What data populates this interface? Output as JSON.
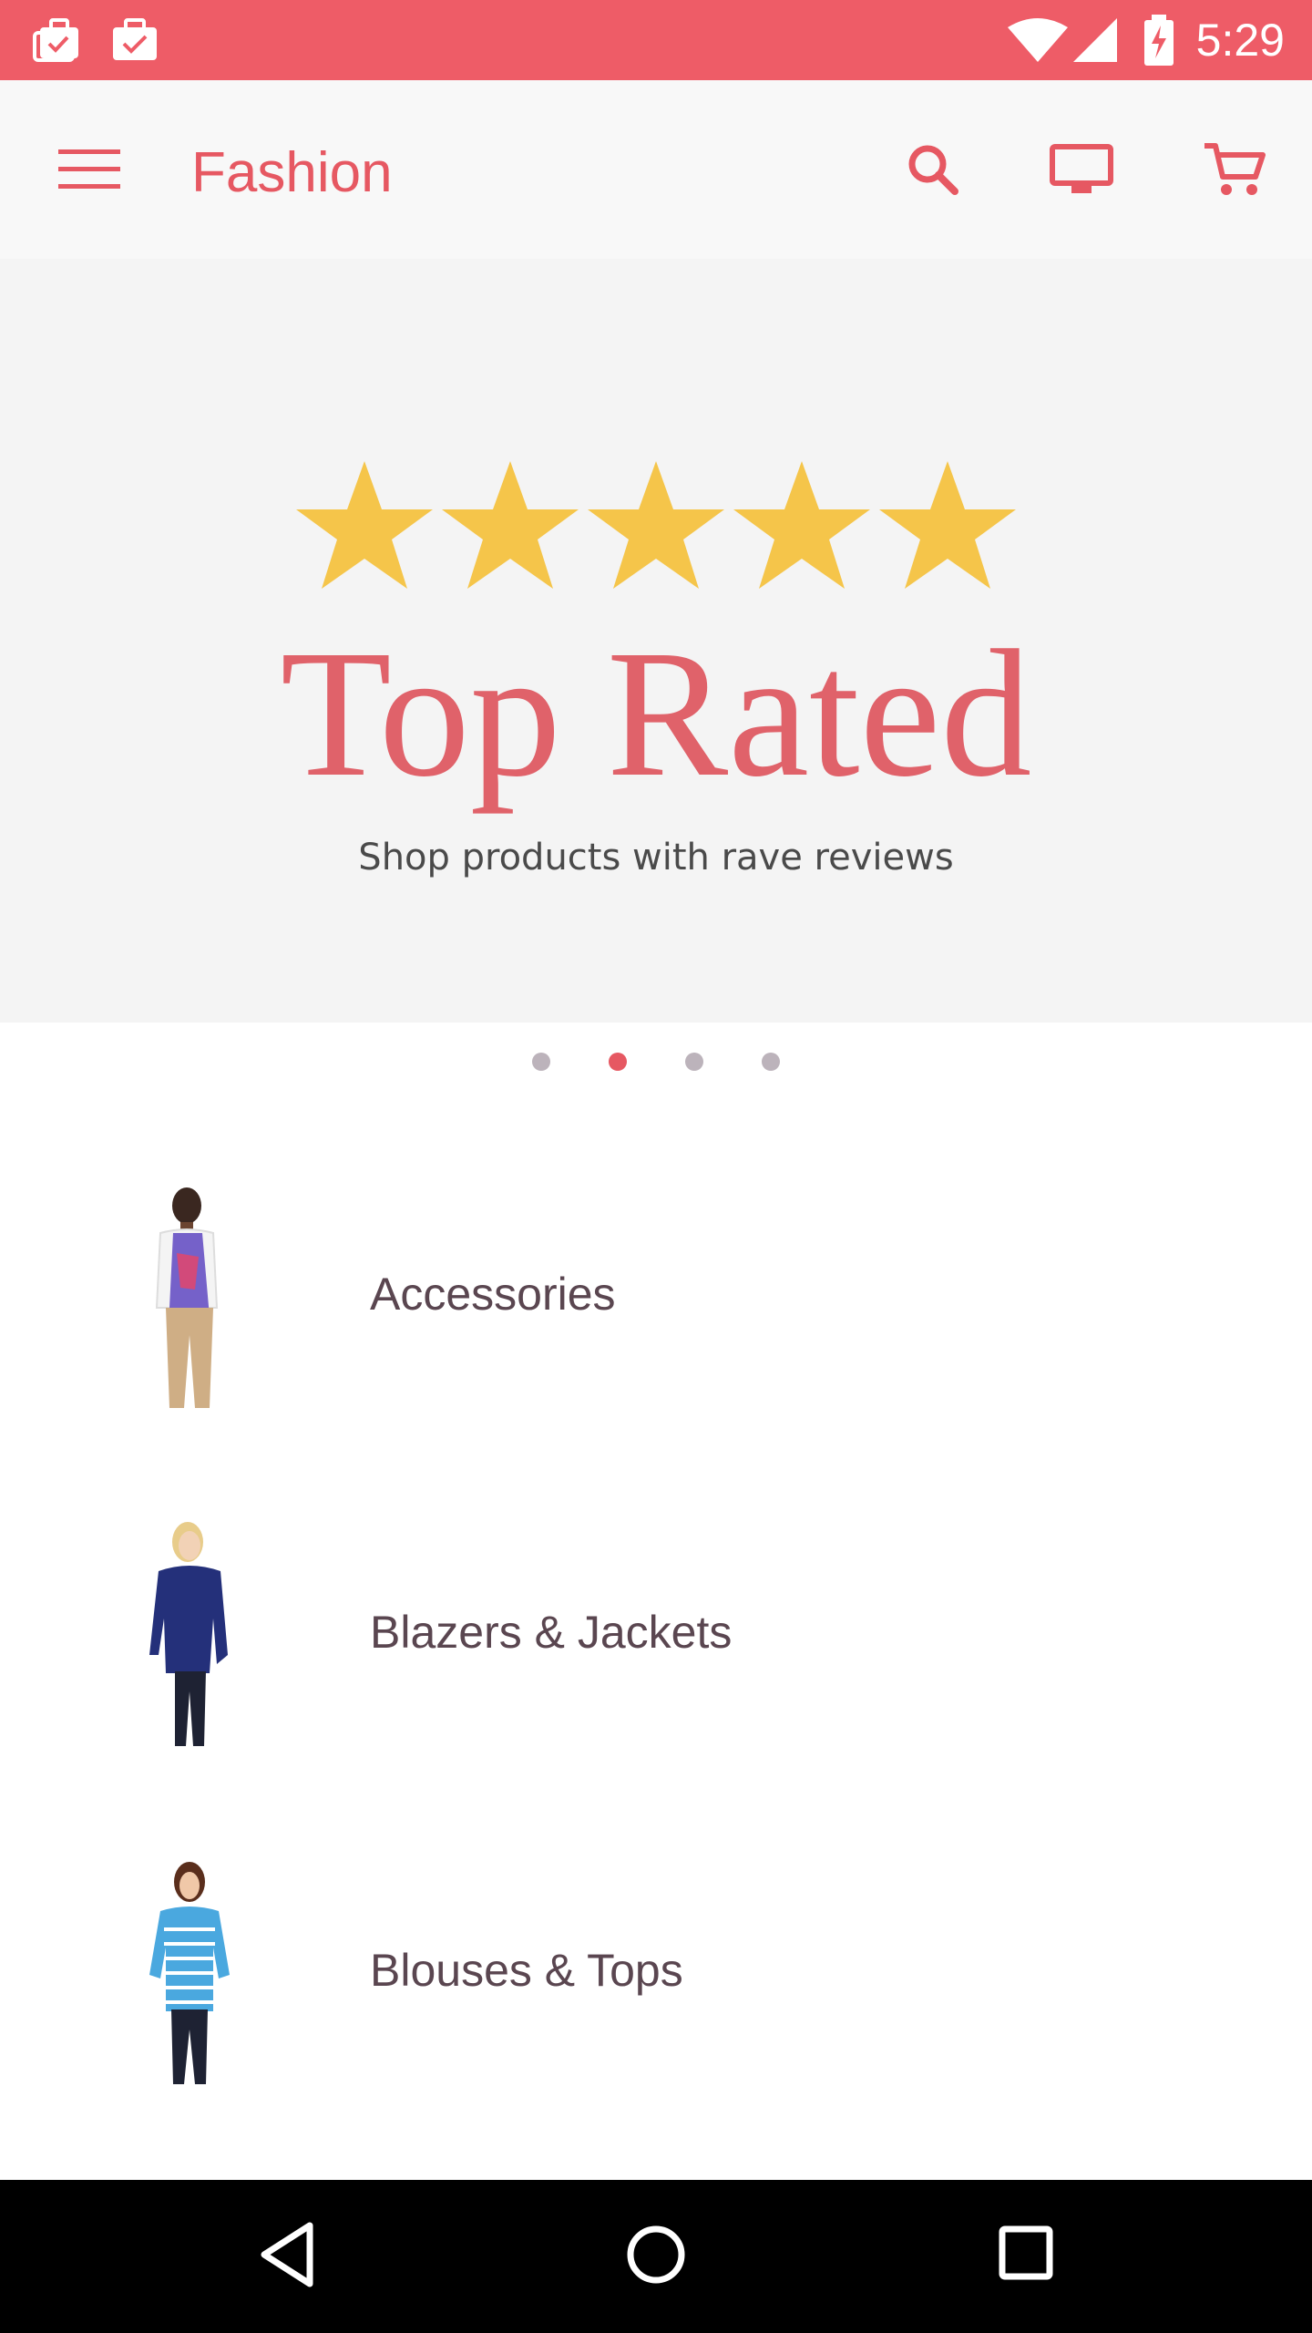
{
  "status_bar": {
    "time": "5:29",
    "notification_icons": [
      "briefcase-check-icon",
      "briefcase-check-icon"
    ],
    "system_icons": [
      "wifi-icon",
      "cell-signal-icon",
      "battery-charging-icon"
    ],
    "background_color": "#ee5c67"
  },
  "app_bar": {
    "title": "Fashion",
    "accent_color": "#e65862",
    "icons": [
      "menu-icon",
      "search-icon",
      "tv-icon",
      "cart-icon"
    ]
  },
  "banner": {
    "title": "Top Rated",
    "subtitle": "Shop products with rave reviews",
    "rating_stars": 5,
    "star_color": "#f5c54a",
    "carousel": {
      "page_count": 4,
      "active_index": 1
    }
  },
  "categories": [
    {
      "label": "Accessories"
    },
    {
      "label": "Blazers & Jackets"
    },
    {
      "label": "Blouses & Tops"
    }
  ],
  "nav_bar": {
    "buttons": [
      "back-icon",
      "home-icon",
      "recents-icon"
    ]
  }
}
